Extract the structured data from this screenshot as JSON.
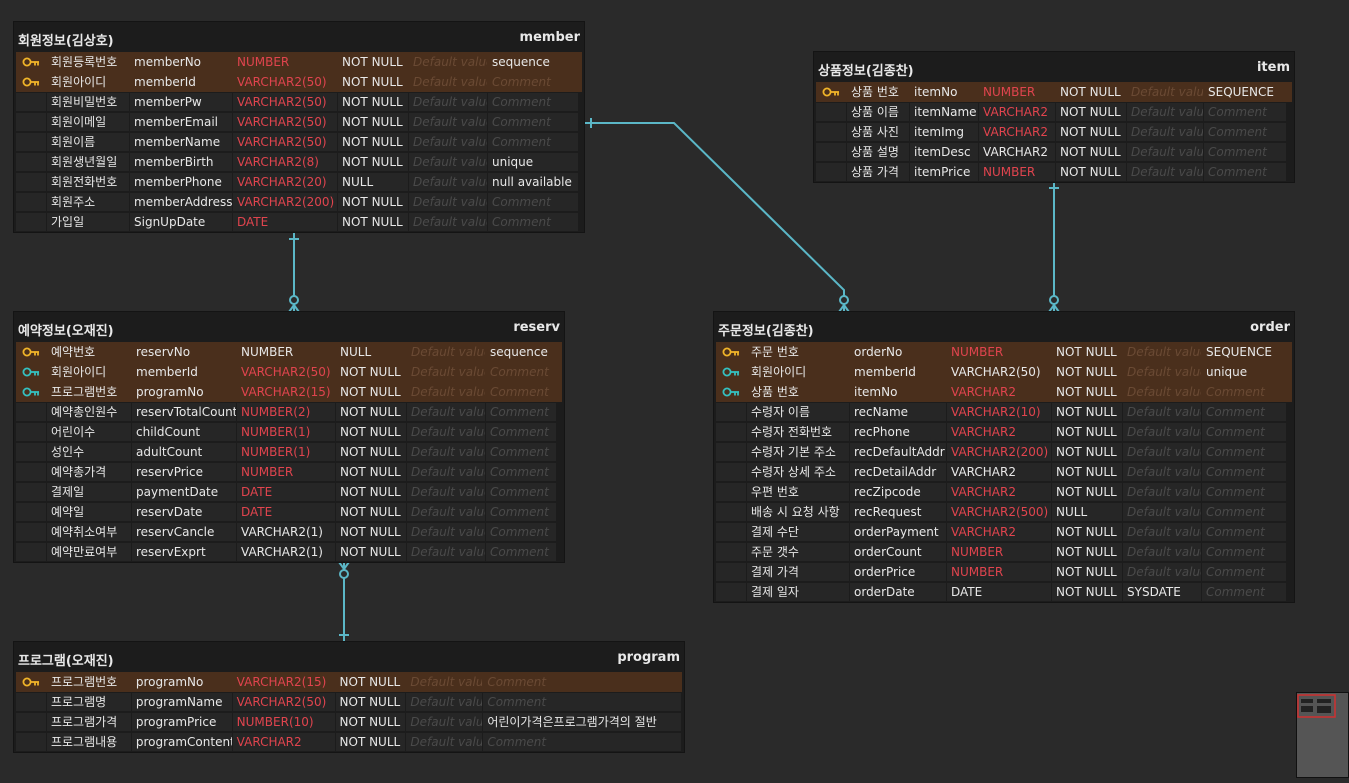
{
  "colors": {
    "background": "#2a2a2a",
    "primary_key": "#f0b429",
    "foreign_key": "#35c0c0",
    "type_red": "#e0444e",
    "relation_line": "#5bb7c7"
  },
  "placeholders": {
    "default": "Default value",
    "comment": "Comment"
  },
  "tables": [
    {
      "id": "member",
      "logical": "회원정보(김상호)",
      "physical": "member",
      "rows": [
        {
          "key": "pk",
          "name": "회원등록번호",
          "col": "memberNo",
          "type": "NUMBER",
          "typeRed": true,
          "nn": "NOT NULL",
          "def": "",
          "cmt": "sequence"
        },
        {
          "key": "pk",
          "name": "회원아이디",
          "col": "memberId",
          "type": "VARCHAR2(50)",
          "typeRed": true,
          "nn": "NOT NULL",
          "def": "",
          "cmt": ""
        },
        {
          "key": "",
          "name": "회원비밀번호",
          "col": "memberPw",
          "type": "VARCHAR2(50)",
          "typeRed": true,
          "nn": "NOT NULL",
          "def": "",
          "cmt": ""
        },
        {
          "key": "",
          "name": "회원이메일",
          "col": "memberEmail",
          "type": "VARCHAR2(50)",
          "typeRed": true,
          "nn": "NOT NULL",
          "def": "",
          "cmt": ""
        },
        {
          "key": "",
          "name": "회원이름",
          "col": "memberName",
          "type": "VARCHAR2(50)",
          "typeRed": true,
          "nn": "NOT NULL",
          "def": "",
          "cmt": ""
        },
        {
          "key": "",
          "name": "회원생년월일",
          "col": "memberBirth",
          "type": "VARCHAR2(8)",
          "typeRed": true,
          "nn": "NOT NULL",
          "def": "",
          "cmt": "unique"
        },
        {
          "key": "",
          "name": "회원전화번호",
          "col": "memberPhone",
          "type": "VARCHAR2(20)",
          "typeRed": true,
          "nn": "NULL",
          "def": "",
          "cmt": "null available"
        },
        {
          "key": "",
          "name": "회원주소",
          "col": "memberAddress",
          "type": "VARCHAR2(200)",
          "typeRed": true,
          "nn": "NOT NULL",
          "def": "",
          "cmt": ""
        },
        {
          "key": "",
          "name": "가입일",
          "col": "SignUpDate",
          "type": "DATE",
          "typeRed": true,
          "nn": "NOT NULL",
          "def": "",
          "cmt": ""
        }
      ]
    },
    {
      "id": "item",
      "logical": "상품정보(김종찬)",
      "physical": "item",
      "rows": [
        {
          "key": "pk",
          "name": "상품 번호",
          "col": "itemNo",
          "type": "NUMBER",
          "typeRed": true,
          "nn": "NOT NULL",
          "def": "",
          "cmt": "SEQUENCE"
        },
        {
          "key": "",
          "name": "상품 이름",
          "col": "itemName",
          "type": "VARCHAR2",
          "typeRed": true,
          "nn": "NOT NULL",
          "def": "",
          "cmt": ""
        },
        {
          "key": "",
          "name": "상품 사진",
          "col": "itemImg",
          "type": "VARCHAR2",
          "typeRed": true,
          "nn": "NOT NULL",
          "def": "",
          "cmt": ""
        },
        {
          "key": "",
          "name": "상품 설명",
          "col": "itemDesc",
          "type": "VARCHAR2",
          "typeRed": false,
          "nn": "NOT NULL",
          "def": "",
          "cmt": ""
        },
        {
          "key": "",
          "name": "상품 가격",
          "col": "itemPrice",
          "type": "NUMBER",
          "typeRed": true,
          "nn": "NOT NULL",
          "def": "",
          "cmt": ""
        }
      ]
    },
    {
      "id": "reserv",
      "logical": "예약정보(오재진)",
      "physical": "reserv",
      "rows": [
        {
          "key": "pk",
          "name": "예약번호",
          "col": "reservNo",
          "type": "NUMBER",
          "typeRed": false,
          "nn": "NULL",
          "def": "",
          "cmt": "sequence"
        },
        {
          "key": "pfk",
          "name": "회원아이디",
          "col": "memberId",
          "type": "VARCHAR2(50)",
          "typeRed": true,
          "nn": "NOT NULL",
          "def": "",
          "cmt": ""
        },
        {
          "key": "pfk",
          "name": "프로그램번호",
          "col": "programNo",
          "type": "VARCHAR2(15)",
          "typeRed": true,
          "nn": "NOT NULL",
          "def": "",
          "cmt": ""
        },
        {
          "key": "",
          "name": "예약총인원수",
          "col": "reservTotalCount",
          "type": "NUMBER(2)",
          "typeRed": true,
          "nn": "NOT NULL",
          "def": "",
          "cmt": ""
        },
        {
          "key": "",
          "name": "어린이수",
          "col": "childCount",
          "type": "NUMBER(1)",
          "typeRed": true,
          "nn": "NOT NULL",
          "def": "",
          "cmt": ""
        },
        {
          "key": "",
          "name": "성인수",
          "col": "adultCount",
          "type": "NUMBER(1)",
          "typeRed": true,
          "nn": "NOT NULL",
          "def": "",
          "cmt": ""
        },
        {
          "key": "",
          "name": "예약총가격",
          "col": "reservPrice",
          "type": "NUMBER",
          "typeRed": true,
          "nn": "NOT NULL",
          "def": "",
          "cmt": ""
        },
        {
          "key": "",
          "name": "결제일",
          "col": "paymentDate",
          "type": "DATE",
          "typeRed": true,
          "nn": "NOT NULL",
          "def": "",
          "cmt": ""
        },
        {
          "key": "",
          "name": "예약일",
          "col": "reservDate",
          "type": "DATE",
          "typeRed": true,
          "nn": "NOT NULL",
          "def": "",
          "cmt": ""
        },
        {
          "key": "",
          "name": "예약취소여부",
          "col": "reservCancle",
          "type": "VARCHAR2(1)",
          "typeRed": false,
          "nn": "NOT NULL",
          "def": "",
          "cmt": ""
        },
        {
          "key": "",
          "name": "예약만료여부",
          "col": "reservExprt",
          "type": "VARCHAR2(1)",
          "typeRed": false,
          "nn": "NOT NULL",
          "def": "",
          "cmt": ""
        }
      ]
    },
    {
      "id": "order",
      "logical": "주문정보(김종찬)",
      "physical": "order",
      "rows": [
        {
          "key": "pk",
          "name": "주문 번호",
          "col": "orderNo",
          "type": "NUMBER",
          "typeRed": true,
          "nn": "NOT NULL",
          "def": "",
          "cmt": "SEQUENCE"
        },
        {
          "key": "pfk",
          "name": "회원아이디",
          "col": "memberId",
          "type": "VARCHAR2(50)",
          "typeRed": false,
          "nn": "NOT NULL",
          "def": "",
          "cmt": "unique"
        },
        {
          "key": "pfk",
          "name": "상품 번호",
          "col": "itemNo",
          "type": "VARCHAR2",
          "typeRed": true,
          "nn": "NOT NULL",
          "def": "",
          "cmt": ""
        },
        {
          "key": "",
          "name": "수령자 이름",
          "col": "recName",
          "type": "VARCHAR2(10)",
          "typeRed": true,
          "nn": "NOT NULL",
          "def": "",
          "cmt": ""
        },
        {
          "key": "",
          "name": "수령자 전화번호",
          "col": "recPhone",
          "type": "VARCHAR2",
          "typeRed": true,
          "nn": "NOT NULL",
          "def": "",
          "cmt": ""
        },
        {
          "key": "",
          "name": "수령자 기본 주소",
          "col": "recDefaultAddr",
          "type": "VARCHAR2(200)",
          "typeRed": true,
          "nn": "NOT NULL",
          "def": "",
          "cmt": ""
        },
        {
          "key": "",
          "name": "수령자 상세 주소",
          "col": "recDetailAddr",
          "type": "VARCHAR2",
          "typeRed": false,
          "nn": "NOT NULL",
          "def": "",
          "cmt": ""
        },
        {
          "key": "",
          "name": "우편 번호",
          "col": "recZipcode",
          "type": "VARCHAR2",
          "typeRed": true,
          "nn": "NOT NULL",
          "def": "",
          "cmt": ""
        },
        {
          "key": "",
          "name": "배송 시 요청 사항",
          "col": "recRequest",
          "type": "VARCHAR2(500)",
          "typeRed": true,
          "nn": "NULL",
          "def": "",
          "cmt": ""
        },
        {
          "key": "",
          "name": "결제 수단",
          "col": "orderPayment",
          "type": "VARCHAR2",
          "typeRed": true,
          "nn": "NOT NULL",
          "def": "",
          "cmt": ""
        },
        {
          "key": "",
          "name": "주문 갯수",
          "col": "orderCount",
          "type": "NUMBER",
          "typeRed": true,
          "nn": "NOT NULL",
          "def": "",
          "cmt": ""
        },
        {
          "key": "",
          "name": "결제 가격",
          "col": "orderPrice",
          "type": "NUMBER",
          "typeRed": true,
          "nn": "NOT NULL",
          "def": "",
          "cmt": ""
        },
        {
          "key": "",
          "name": "결제 일자",
          "col": "orderDate",
          "type": "DATE",
          "typeRed": false,
          "nn": "NOT NULL",
          "def": "SYSDATE",
          "cmt": ""
        }
      ]
    },
    {
      "id": "program",
      "logical": "프로그램(오재진)",
      "physical": "program",
      "rows": [
        {
          "key": "pk",
          "name": "프로그램번호",
          "col": "programNo",
          "type": "VARCHAR2(15)",
          "typeRed": true,
          "nn": "NOT NULL",
          "def": "",
          "cmt": ""
        },
        {
          "key": "",
          "name": "프로그램명",
          "col": "programName",
          "type": "VARCHAR2(50)",
          "typeRed": true,
          "nn": "NOT NULL",
          "def": "",
          "cmt": ""
        },
        {
          "key": "",
          "name": "프로그램가격",
          "col": "programPrice",
          "type": "NUMBER(10)",
          "typeRed": true,
          "nn": "NOT NULL",
          "def": "",
          "cmt": "어린이가격은프로그램가격의 절반"
        },
        {
          "key": "",
          "name": "프로그램내용",
          "col": "programContent",
          "type": "VARCHAR2",
          "typeRed": true,
          "nn": "NOT NULL",
          "def": "",
          "cmt": ""
        }
      ]
    }
  ]
}
